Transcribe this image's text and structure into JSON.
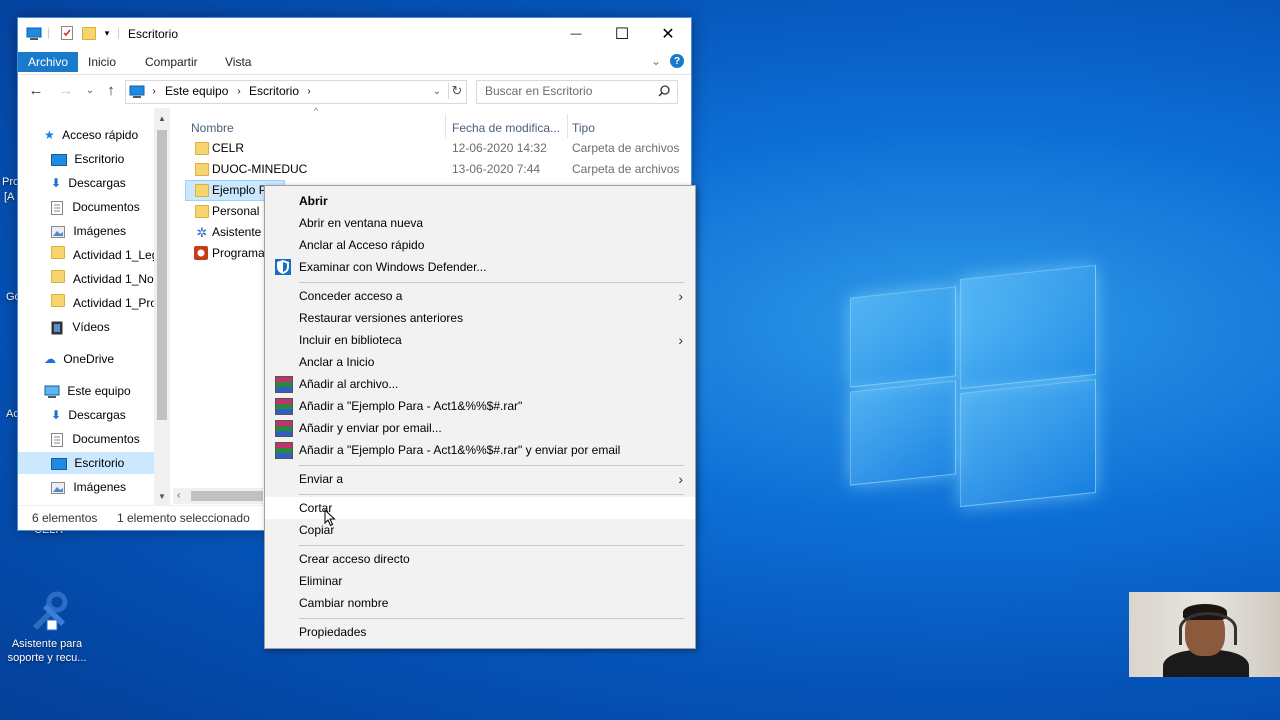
{
  "window": {
    "title": "Escritorio",
    "controls": {
      "minimize": "—",
      "maximize": "☐",
      "close": "✕"
    },
    "ribbon_tabs": [
      "Archivo",
      "Inicio",
      "Compartir",
      "Vista"
    ],
    "address": {
      "segments": [
        "Este equipo",
        "Escritorio"
      ]
    },
    "search": {
      "placeholder": "Buscar en Escritorio"
    },
    "nav": {
      "quick_access": "Acceso rápido",
      "items": [
        "Escritorio",
        "Descargas",
        "Documentos",
        "Imágenes",
        "Actividad 1_Leg",
        "Actividad 1_No",
        "Actividad 1_Pro",
        "Vídeos"
      ],
      "onedrive": "OneDrive",
      "this_pc": "Este equipo",
      "pc_items": [
        "Descargas",
        "Documentos",
        "Escritorio",
        "Imágenes"
      ]
    },
    "columns": {
      "name": "Nombre",
      "date": "Fecha de modifica...",
      "type": "Tipo"
    },
    "files": [
      {
        "name": "CELR",
        "date": "12-06-2020 14:32",
        "type": "Carpeta de archivos"
      },
      {
        "name": "DUOC-MINEDUC",
        "date": "13-06-2020 7:44",
        "type": "Carpeta de archivos"
      },
      {
        "name": "Ejemplo P",
        "date": "",
        "type": ""
      },
      {
        "name": "Personal",
        "date": "",
        "type": ""
      },
      {
        "name": "Asistente p",
        "date": "",
        "type": ""
      },
      {
        "name": "Programa",
        "date": "",
        "type": ""
      }
    ],
    "status": {
      "count": "6 elementos",
      "selected": "1 elemento seleccionado"
    }
  },
  "context_menu": {
    "group1": [
      "Abrir",
      "Abrir en ventana nueva",
      "Anclar al Acceso rápido",
      "Examinar con Windows Defender..."
    ],
    "group2": [
      "Conceder acceso a",
      "Restaurar versiones anteriores",
      "Incluir en biblioteca",
      "Anclar a Inicio",
      "Añadir al archivo...",
      "Añadir a \"Ejemplo Para - Act1&%%$#.rar\"",
      "Añadir y enviar por email...",
      "Añadir a \"Ejemplo Para - Act1&%%$#.rar\" y enviar por email"
    ],
    "group3": [
      "Enviar a"
    ],
    "group4": [
      "Cortar",
      "Copiar"
    ],
    "group5": [
      "Crear acceso directo",
      "Eliminar",
      "Cambiar nombre"
    ],
    "group6": [
      "Propiedades"
    ]
  },
  "desktop": {
    "icons": [
      {
        "label": "Asistente para soporte y recu..."
      }
    ],
    "fragments": [
      "Pro",
      "[A",
      "Go",
      "Ac",
      "CELR"
    ]
  },
  "colors": {
    "accent": "#1979ca",
    "selection": "#cce8ff"
  }
}
